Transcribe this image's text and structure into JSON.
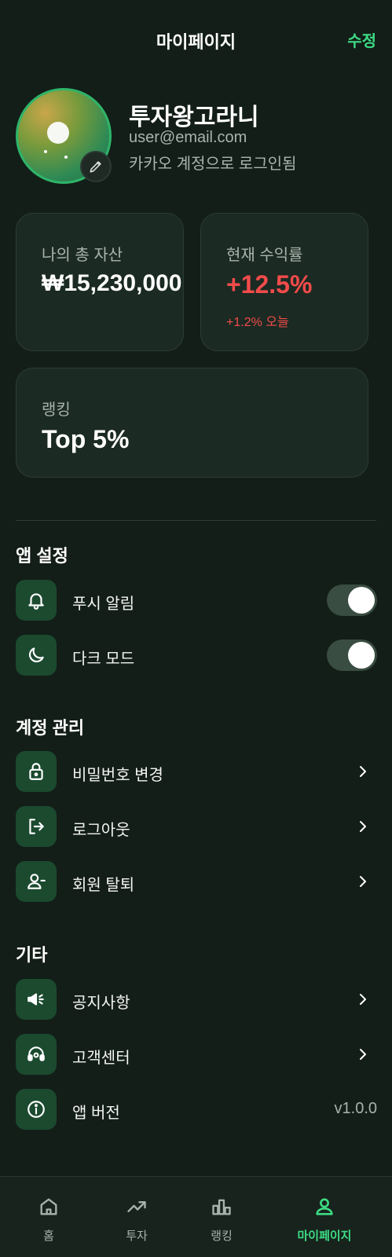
{
  "header": {
    "title": "마이페이지",
    "edit_label": "수정"
  },
  "profile": {
    "name": "투자왕고라니",
    "email": "user@email.com",
    "login_status": "카카오 계정으로 로그인됨"
  },
  "cards": {
    "total_assets": {
      "label": "나의 총 자산",
      "value": "₩15,230,000"
    },
    "return_rate": {
      "label": "현재 수익률",
      "value": "+12.5%",
      "sub": "+1.2% 오늘"
    },
    "ranking": {
      "label": "랭킹",
      "value": "Top 5%"
    }
  },
  "sections": {
    "app_settings": {
      "title": "앱 설정",
      "items": [
        {
          "label": "푸시 알림",
          "icon": "bell-icon",
          "toggle_on": true
        },
        {
          "label": "다크 모드",
          "icon": "moon-icon",
          "toggle_on": true
        }
      ]
    },
    "account": {
      "title": "계정 관리",
      "items": [
        {
          "label": "비밀번호 변경",
          "icon": "lock-icon"
        },
        {
          "label": "로그아웃",
          "icon": "logout-icon"
        },
        {
          "label": "회원 탈퇴",
          "icon": "user-minus-icon"
        }
      ]
    },
    "etc": {
      "title": "기타",
      "items": [
        {
          "label": "공지사항",
          "icon": "megaphone-icon"
        },
        {
          "label": "고객센터",
          "icon": "headset-icon"
        },
        {
          "label": "앱 버전",
          "icon": "info-icon",
          "value": "v1.0.0"
        }
      ]
    }
  },
  "bottom_nav": {
    "items": [
      {
        "label": "홈",
        "icon": "home-icon"
      },
      {
        "label": "투자",
        "icon": "trending-up-icon"
      },
      {
        "label": "랭킹",
        "icon": "bar-chart-icon"
      },
      {
        "label": "마이페이지",
        "icon": "user-icon",
        "active": true
      }
    ]
  },
  "colors": {
    "background": "#131e18",
    "accent": "#3ddc84",
    "positive_return": "#f24b4b",
    "card": "#1b2a22",
    "icon_box": "#1b4a2f"
  }
}
